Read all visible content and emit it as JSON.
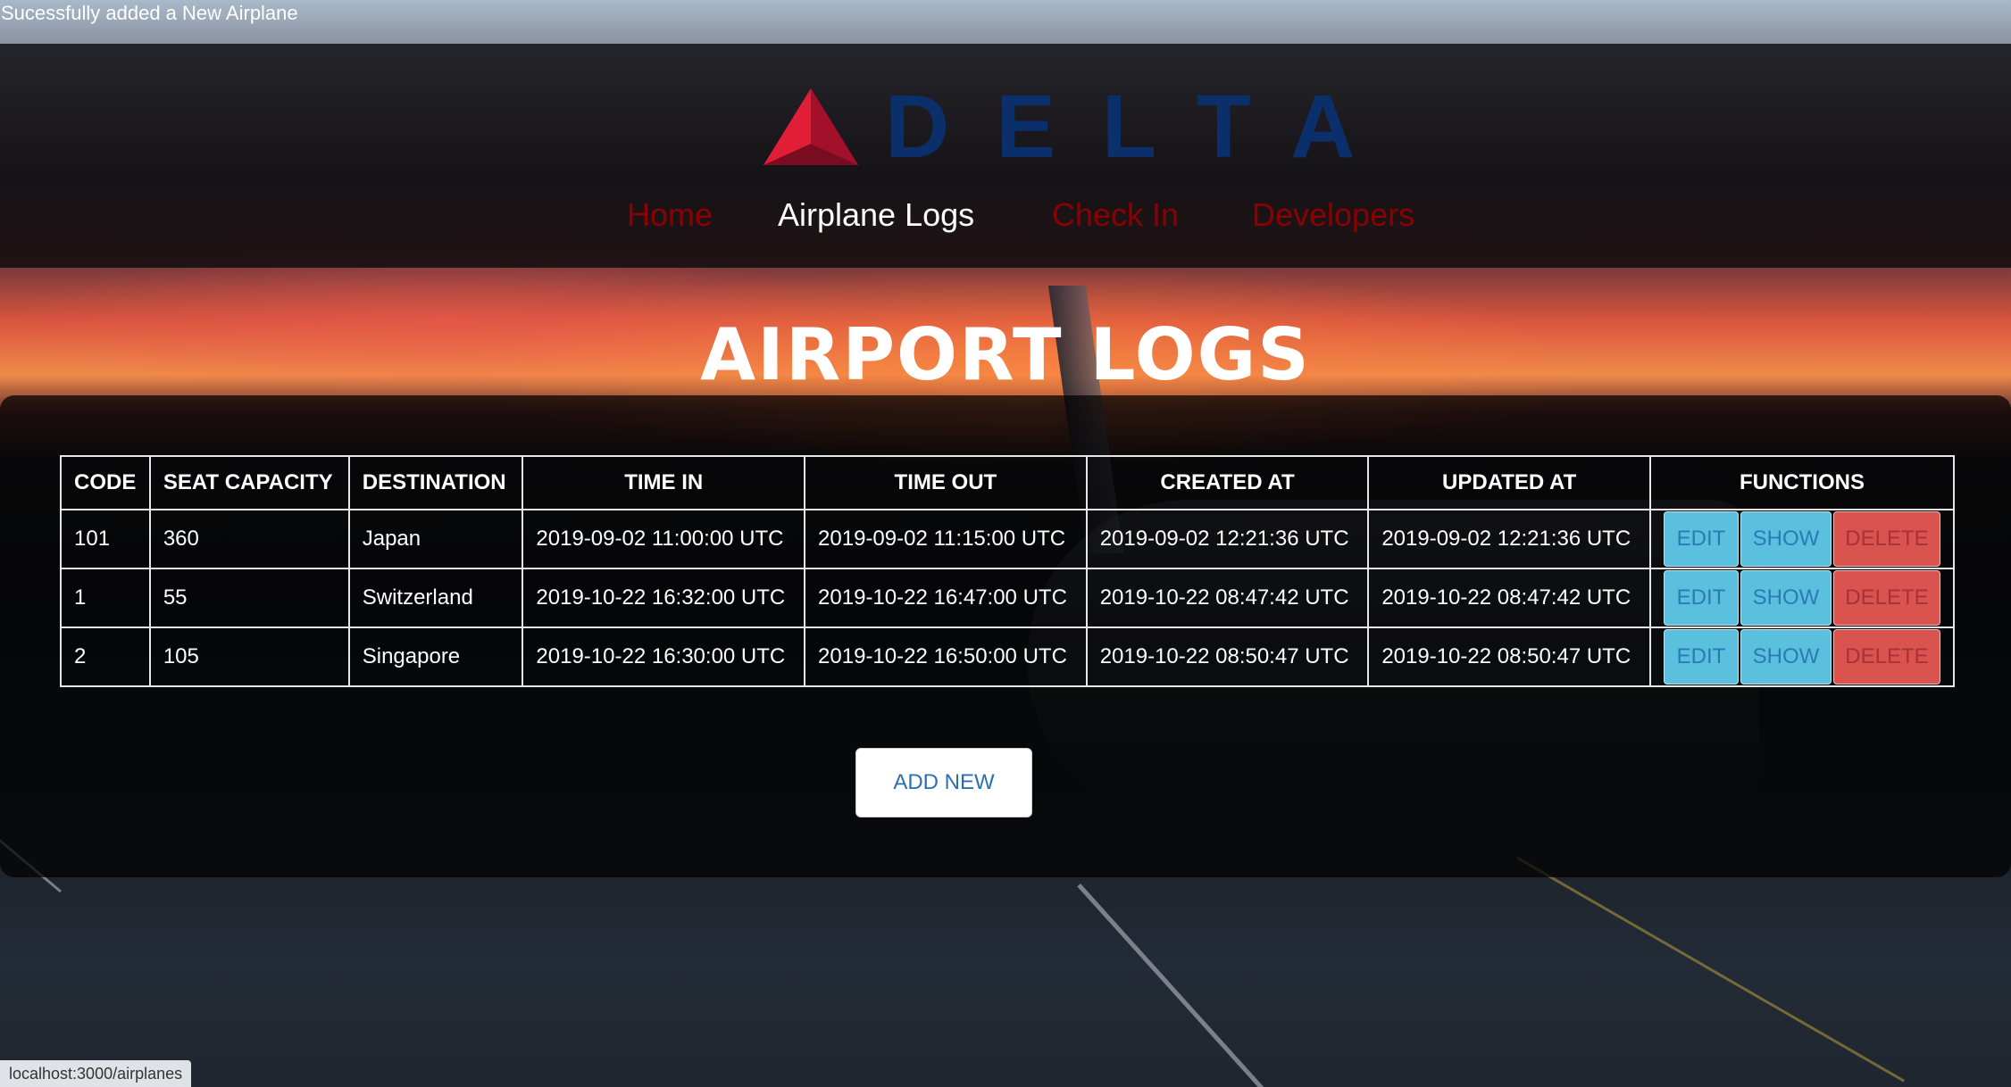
{
  "flash": {
    "message": "Sucessfully added a New Airplane"
  },
  "brand": {
    "name": "DELTA",
    "colors": {
      "mark_red": "#c8102e",
      "text_blue": "#0a2f6b"
    }
  },
  "nav": {
    "items": [
      {
        "label": "Home"
      },
      {
        "label": "Airplane Logs"
      },
      {
        "label": "Check In"
      },
      {
        "label": "Developers"
      }
    ],
    "active_index": 1
  },
  "page": {
    "title": "AIRPORT LOGS"
  },
  "table": {
    "headers": [
      "CODE",
      "SEAT CAPACITY",
      "DESTINATION",
      "TIME IN",
      "TIME OUT",
      "CREATED AT",
      "UPDATED AT",
      "FUNCTIONS"
    ],
    "rows": [
      {
        "code": "101",
        "seat_capacity": "360",
        "destination": "Japan",
        "time_in": "2019-09-02 11:00:00 UTC",
        "time_out": "2019-09-02 11:15:00 UTC",
        "created_at": "2019-09-02 12:21:36 UTC",
        "updated_at": "2019-09-02 12:21:36 UTC"
      },
      {
        "code": "1",
        "seat_capacity": "55",
        "destination": "Switzerland",
        "time_in": "2019-10-22 16:32:00 UTC",
        "time_out": "2019-10-22 16:47:00 UTC",
        "created_at": "2019-10-22 08:47:42 UTC",
        "updated_at": "2019-10-22 08:47:42 UTC"
      },
      {
        "code": "2",
        "seat_capacity": "105",
        "destination": "Singapore",
        "time_in": "2019-10-22 16:30:00 UTC",
        "time_out": "2019-10-22 16:50:00 UTC",
        "created_at": "2019-10-22 08:50:47 UTC",
        "updated_at": "2019-10-22 08:50:47 UTC"
      }
    ],
    "actions": {
      "edit": "EDIT",
      "show": "SHOW",
      "delete": "DELETE"
    }
  },
  "add_new": {
    "label": "ADD NEW"
  },
  "status_bar": {
    "url": "localhost:3000/airplanes"
  },
  "colors": {
    "nav_inactive": "#8b0000",
    "nav_active": "#ffffff",
    "btn_info": "#5bc0de",
    "btn_danger": "#d9534f"
  }
}
